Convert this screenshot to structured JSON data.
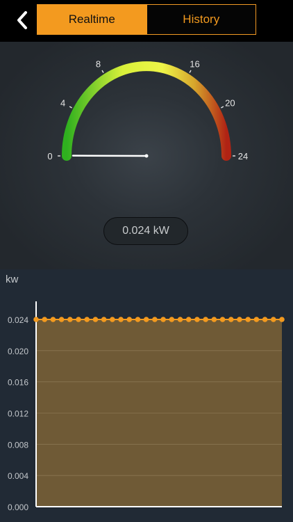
{
  "header": {
    "tabs": [
      {
        "label": "Realtime",
        "active": true
      },
      {
        "label": "History",
        "active": false
      }
    ],
    "accent_color": "#f39a1f"
  },
  "gauge": {
    "min": 0,
    "max": 24,
    "ticks": [
      {
        "value": 0,
        "label": "0"
      },
      {
        "value": 4,
        "label": "4"
      },
      {
        "value": 8,
        "label": "8"
      },
      {
        "value": 16,
        "label": "16"
      },
      {
        "value": 20,
        "label": "20"
      },
      {
        "value": 24,
        "label": "24"
      }
    ],
    "current_value": 0.024,
    "readout": "0.024 kW",
    "colors": [
      "#2fb01f",
      "#e9f53a",
      "#e2c232",
      "#b02314"
    ]
  },
  "chart": {
    "unit_label": "kw"
  },
  "chart_data": {
    "type": "area",
    "ylabel": "kw",
    "ylim": [
      0,
      0.024
    ],
    "yticks": [
      "0.000",
      "0.004",
      "0.008",
      "0.012",
      "0.016",
      "0.020",
      "0.024"
    ],
    "values": [
      0.024,
      0.024,
      0.024,
      0.024,
      0.024,
      0.024,
      0.024,
      0.024,
      0.024,
      0.024,
      0.024,
      0.024,
      0.024,
      0.024,
      0.024,
      0.024,
      0.024,
      0.024,
      0.024,
      0.024,
      0.024,
      0.024,
      0.024,
      0.024,
      0.024,
      0.024,
      0.024,
      0.024,
      0.024,
      0.024
    ],
    "line_color": "#f39a1f",
    "fill_color": "#6f5a36",
    "grid": true
  }
}
